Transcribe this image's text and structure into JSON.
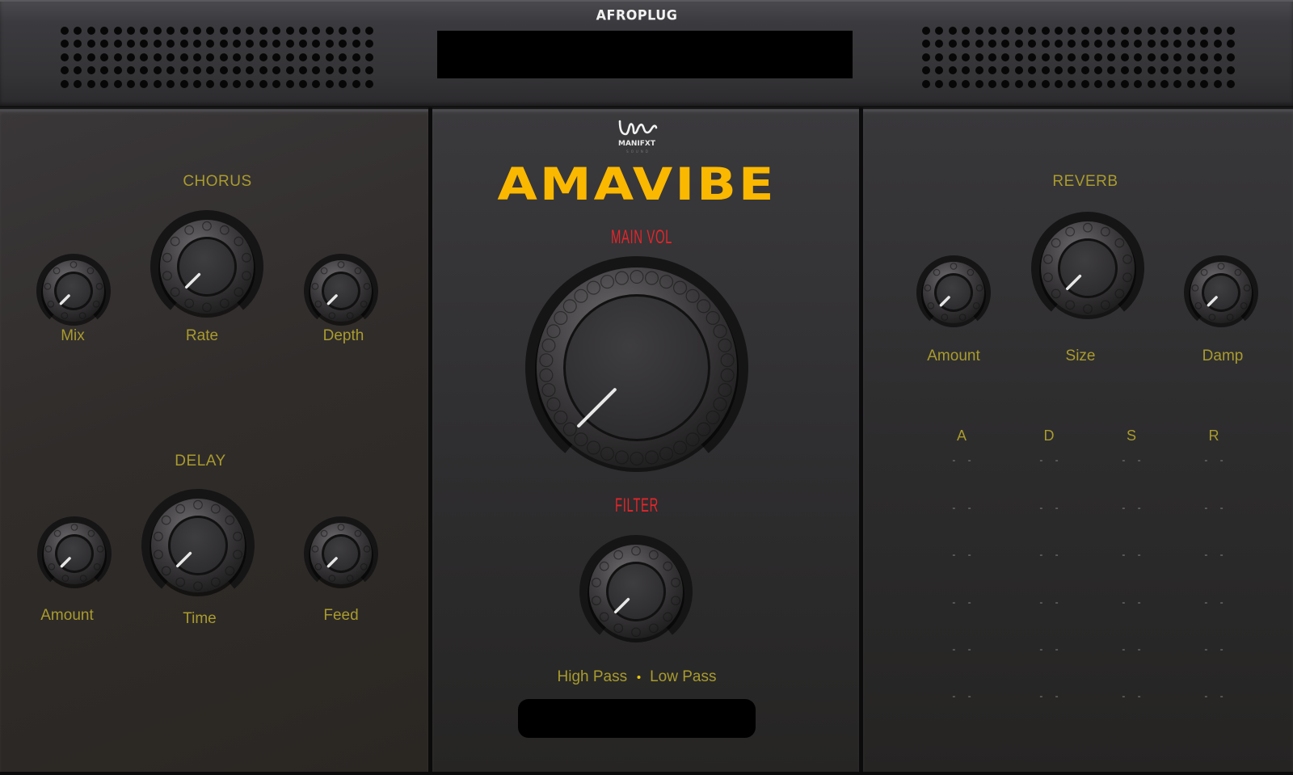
{
  "app": {
    "brand": "AFROPLUG",
    "product_title": "AMAVIBE",
    "maker_logo": "MANIFXT",
    "maker_sub": "SOUND",
    "accent_color": "#fbb800",
    "label_color": "#a99b2e",
    "red_label_color": "#e3262b"
  },
  "chorus": {
    "title": "CHORUS",
    "knobs": [
      {
        "label": "Mix",
        "value": 0
      },
      {
        "label": "Rate",
        "value": 0
      },
      {
        "label": "Depth",
        "value": 0
      }
    ]
  },
  "delay": {
    "title": "DELAY",
    "knobs": [
      {
        "label": "Amount",
        "value": 0
      },
      {
        "label": "Time",
        "value": 0
      },
      {
        "label": "Feed",
        "value": 0
      }
    ]
  },
  "center": {
    "main_vol": {
      "label": "MAIN VOL",
      "value": 0
    },
    "filter": {
      "label": "FILTER",
      "value": 0
    },
    "filter_modes": [
      "High Pass",
      "Low Pass"
    ]
  },
  "reverb": {
    "title": "REVERB",
    "knobs": [
      {
        "label": "Amount",
        "value": 0
      },
      {
        "label": "Size",
        "value": 0
      },
      {
        "label": "Damp",
        "value": 0
      }
    ]
  },
  "adsr": {
    "columns": [
      "A",
      "D",
      "S",
      "R"
    ],
    "placeholder": "- -",
    "rows": 6
  },
  "icons": {
    "grille": "speaker-grille-icon",
    "logo": "manifxt-logo-icon",
    "knob": "knob-icon"
  }
}
